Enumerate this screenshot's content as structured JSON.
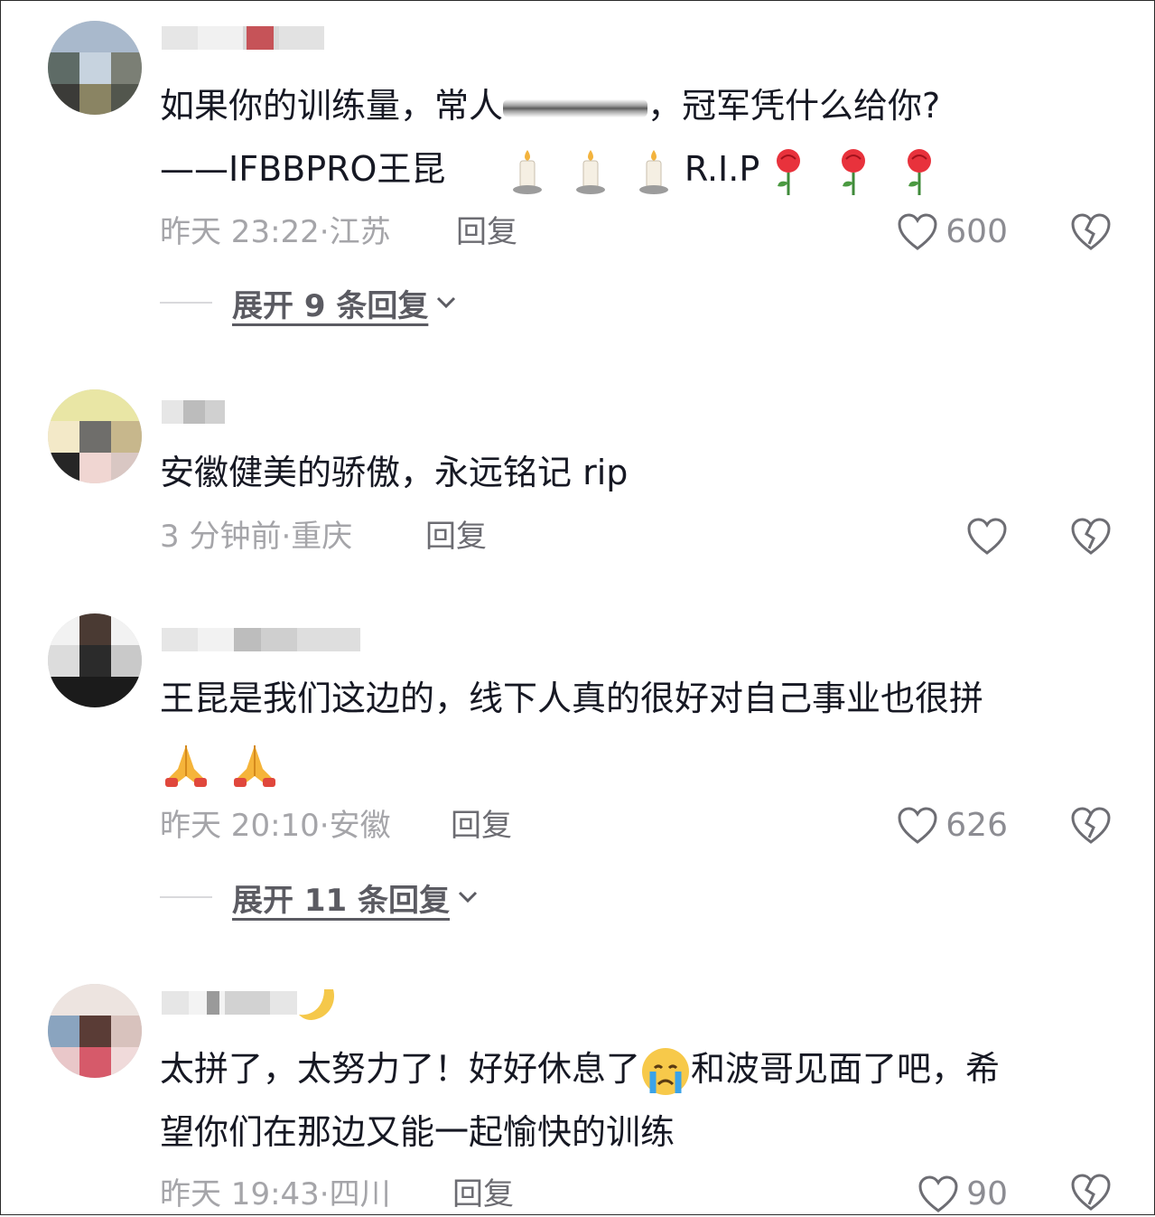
{
  "comments": [
    {
      "text_line1": "如果你的训练量，常人",
      "text_line1_end": "，冠军凭什么给你?",
      "text_line2": "——IFBBPRO王昆",
      "text_line2_tail": "R.I.P",
      "time": "昨天 23:22",
      "location": "江苏",
      "reply_label": "回复",
      "like_count": "600",
      "expand_label": "展开 9 条回复"
    },
    {
      "text_line1": "安徽健美的骄傲，永远铭记 rip",
      "time": "3 分钟前",
      "location": "重庆",
      "reply_label": "回复"
    },
    {
      "text_line1": "王昆是我们这边的，线下人真的很好对自己事业也很拼",
      "time": "昨天 20:10",
      "location": "安徽",
      "reply_label": "回复",
      "like_count": "626",
      "expand_label": "展开 11 条回复"
    },
    {
      "text_line1": "太拼了，太努力了！好好休息了",
      "text_line1_end": "和波哥见面了吧，希",
      "text_line2": "望你们在那边又能一起愉快的训练",
      "time": "昨天 19:43",
      "location": "四川",
      "reply_label": "回复",
      "like_count": "90"
    }
  ],
  "meta_separator": "·",
  "icons": {
    "like": "heart-outline-icon",
    "dislike": "broken-heart-icon",
    "expand": "chevron-down-icon",
    "candle": "candle-emoji",
    "rose": "rose-emoji",
    "pray": "folded-hands-emoji",
    "crying": "crying-face-emoji"
  },
  "colors": {
    "text": "#161823",
    "meta": "#a5a5a9",
    "reply": "#6c6c72",
    "like_count": "#8c8c92"
  }
}
